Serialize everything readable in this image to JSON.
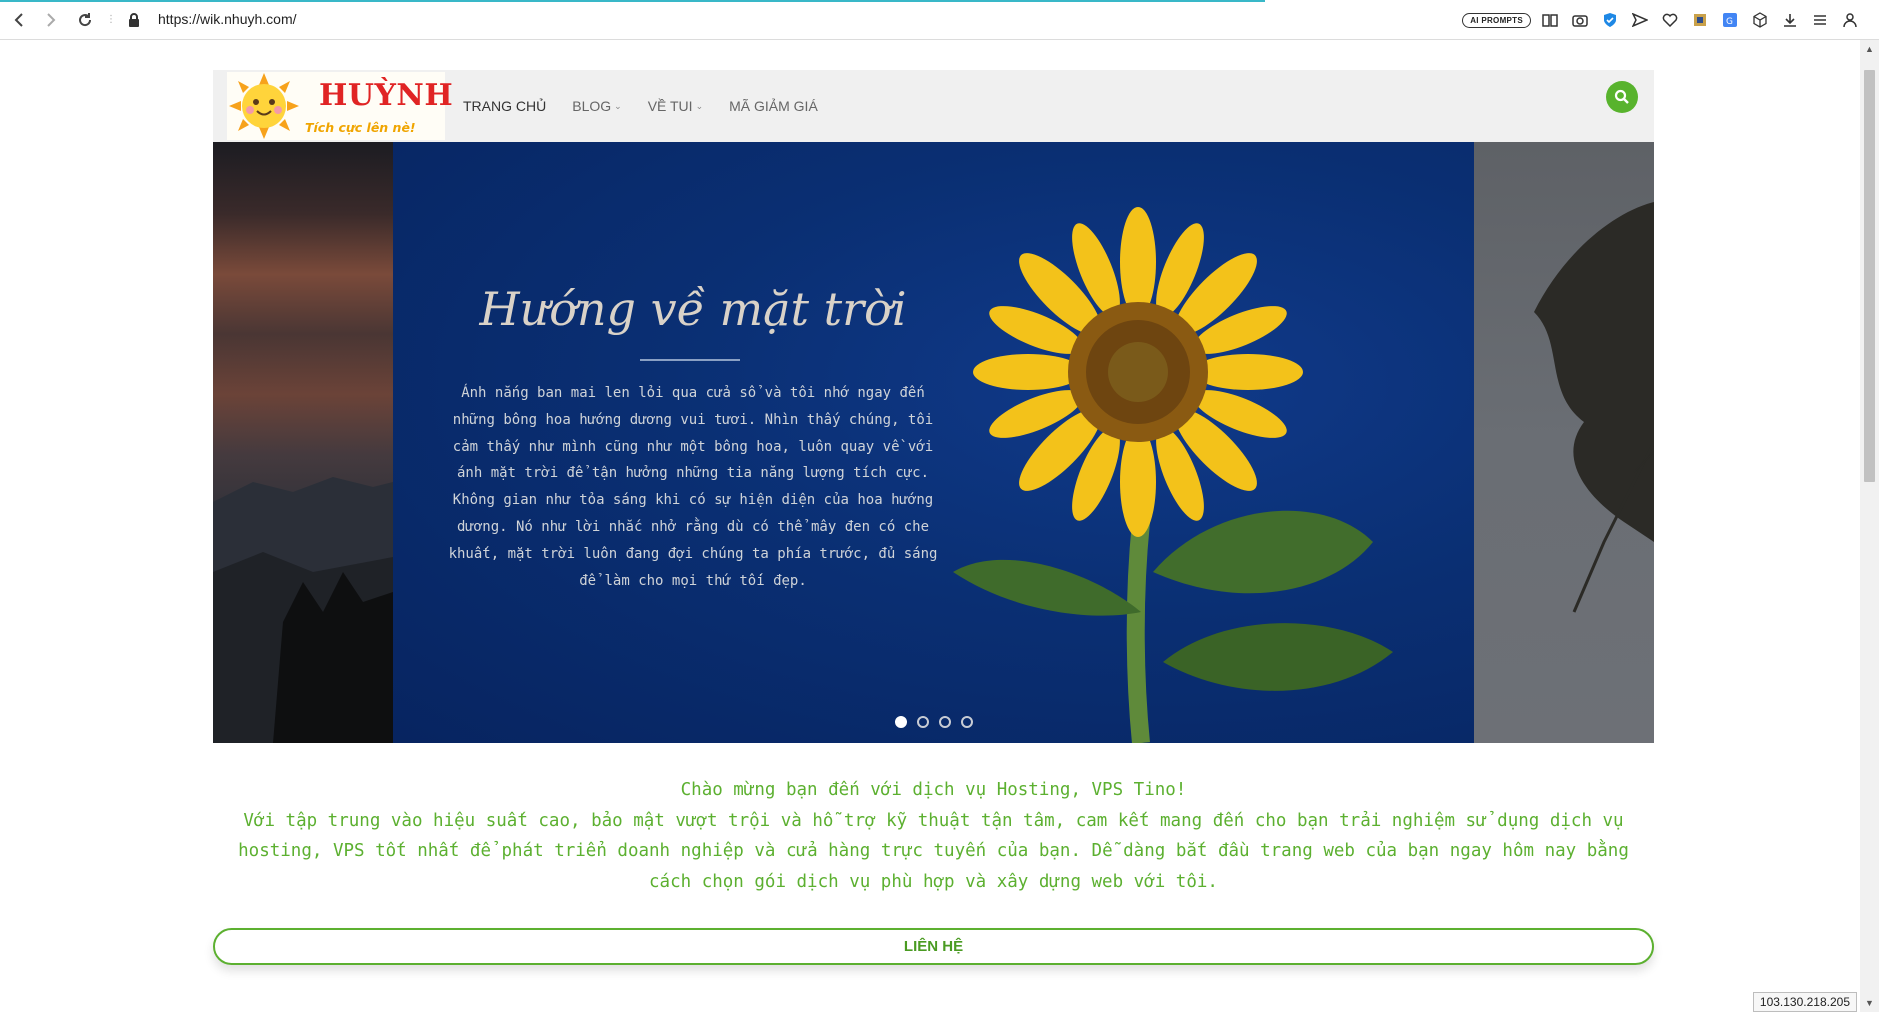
{
  "browser": {
    "url": "https://wik.nhuyh.com/",
    "ai_prompts_label": "AI PROMPTS"
  },
  "site": {
    "logo": {
      "name": "HUỲNH",
      "tagline": "Tích cực lên nè!"
    },
    "menu": [
      {
        "label": "TRANG CHỦ",
        "has_dropdown": false,
        "active": true
      },
      {
        "label": "BLOG",
        "has_dropdown": true,
        "active": false
      },
      {
        "label": "VỀ TUI",
        "has_dropdown": true,
        "active": false
      },
      {
        "label": "MÃ GIẢM GIÁ",
        "has_dropdown": false,
        "active": false
      }
    ],
    "accent_color": "#58b32d"
  },
  "slider": {
    "title": "Hướng về mặt trời",
    "text": "Ánh nắng ban mai len lỏi qua cửa sổ và tôi nhớ ngay đến những bông hoa hướng dương vui tươi. Nhìn thấy chúng, tôi cảm thấy như mình cũng như một bông hoa, luôn quay về với ánh mặt trời để tận hưởng những tia năng lượng tích cực. Không gian như tỏa sáng khi có sự hiện diện của hoa hướng dương. Nó như lời nhắc nhở rằng dù có thể mây đen có che khuất, mặt trời luôn đang đợi chúng ta phía trước, đủ sáng để làm cho mọi thứ tối đẹp.",
    "dots": 4,
    "active_dot": 1
  },
  "welcome": {
    "line1": "Chào mừng bạn đến với dịch vụ Hosting, VPS Tino!",
    "line2": "Với tập trung vào hiệu suất cao, bảo mật vượt trội và hỗ trợ kỹ thuật tận tâm, cam kết mang đến cho bạn trải nghiệm sử dụng dịch vụ hosting, VPS tốt nhất để phát triển doanh nghiệp và cửa hàng trực tuyến của bạn. Dễ dàng bắt đầu trang web của bạn ngay hôm nay bằng cách chọn gói dịch vụ phù hợp và xây dựng web với tôi."
  },
  "contact_button": "LIÊN HỆ",
  "ip_badge": "103.130.218.205"
}
